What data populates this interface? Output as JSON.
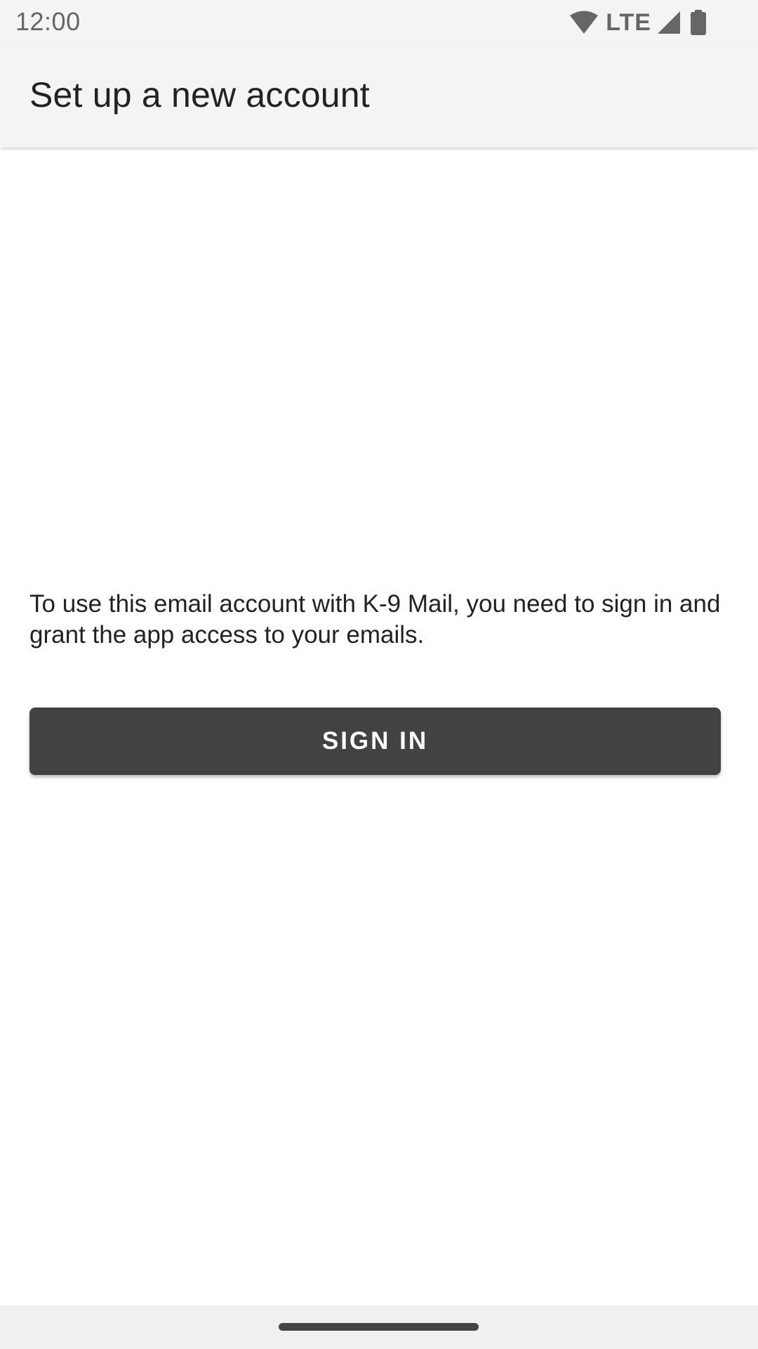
{
  "status_bar": {
    "time": "12:00",
    "network_label": "LTE",
    "icons": [
      "wifi-icon",
      "cell-signal-icon",
      "battery-icon"
    ]
  },
  "app_bar": {
    "title": "Set up a new account"
  },
  "main": {
    "instruction": "To use this email account with K-9 Mail, you need to sign in and grant the app access to your emails.",
    "sign_in_label": "SIGN IN"
  },
  "colors": {
    "bar_background": "#f4f4f4",
    "button_background": "#424242",
    "button_text": "#ffffff",
    "text_primary": "#222222",
    "status_text": "#666666"
  }
}
